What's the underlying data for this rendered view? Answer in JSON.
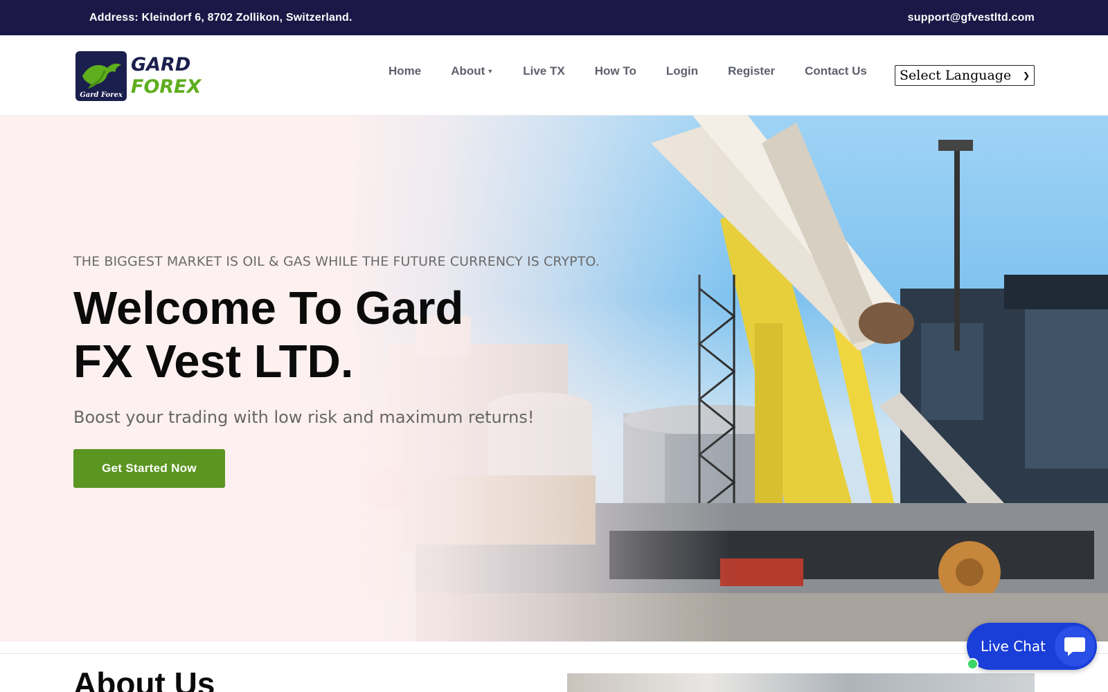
{
  "topbar": {
    "address": "Address: Kleindorf 6, 8702 Zollikon, Switzerland.",
    "email": "support@gfvestltd.com"
  },
  "logo": {
    "line1": "GARD",
    "line2": "FOREX",
    "badge_text": "Gard Forex",
    "colors": {
      "navy": "#1b1f4d",
      "green": "#5fae1e"
    }
  },
  "nav": {
    "items": [
      {
        "label": "Home"
      },
      {
        "label": "About",
        "has_dropdown": true
      },
      {
        "label": "Live TX"
      },
      {
        "label": "How To"
      },
      {
        "label": "Login"
      },
      {
        "label": "Register"
      },
      {
        "label": "Contact Us"
      }
    ],
    "language_select": {
      "selected": "Select Language"
    }
  },
  "hero": {
    "eyebrow": "THE BIGGEST MARKET IS OIL & GAS WHILE THE FUTURE CURRENCY IS CRYPTO.",
    "title": "Welcome To Gard FX Vest LTD.",
    "subtitle": "Boost your trading with low risk and maximum returns!",
    "cta_label": "Get Started Now",
    "cta_color": "#5b9522"
  },
  "about": {
    "title": "About Us"
  },
  "live_chat": {
    "label": "Live Chat",
    "icon": "chat-bubble-icon",
    "status": "online",
    "color": "#1a3ed8"
  }
}
